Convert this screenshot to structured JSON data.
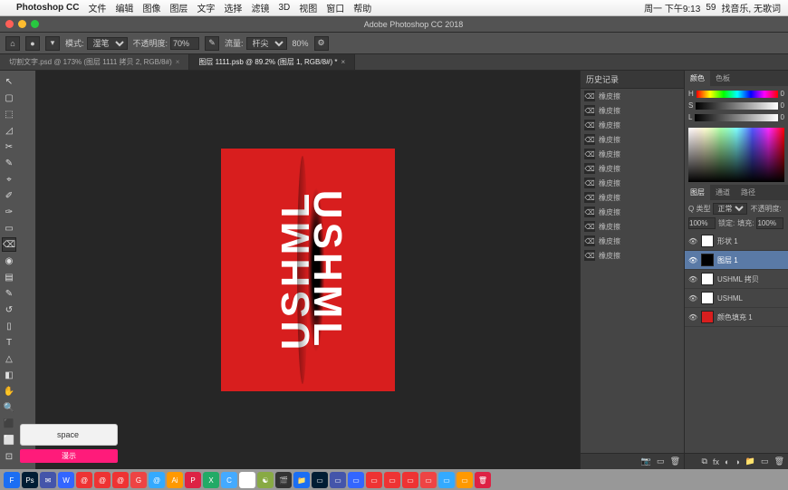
{
  "mac_menu": {
    "apple": "",
    "app_name": "Photoshop CC",
    "items": [
      "文件",
      "编辑",
      "图像",
      "图层",
      "文字",
      "选择",
      "滤镜",
      "3D",
      "视图",
      "窗口",
      "帮助"
    ],
    "right_status": "周一 下午9:13",
    "right_extras": [
      "找音乐, 无歌词"
    ],
    "battery": "59"
  },
  "ps_title": "Adobe Photoshop CC 2018",
  "options": {
    "mode_label": "模式:",
    "mode_value": "湿笔",
    "opacity_label": "不透明度:",
    "opacity_value": "70%",
    "flow_label": "流量:",
    "flow_value": "杆尖",
    "other_label": "80%"
  },
  "doc_tabs": [
    {
      "label": "切割文字.psd @ 173% (图层 1111 拷贝 2, RGB/8#)",
      "active": false
    },
    {
      "label": "图层 1111.psb @ 89.2% (图层 1, RGB/8#) *",
      "active": true
    }
  ],
  "tools": [
    "↖",
    "▢",
    "⬚",
    "◿",
    "✂",
    "✎",
    "⌖",
    "✐",
    "✑",
    "▭",
    "⌫",
    "◉",
    "▤",
    "✎",
    "↺",
    "▯",
    "T",
    "△",
    "◧",
    "✋",
    "🔍",
    "⬛",
    "⬜",
    "⊡"
  ],
  "canvas_text": "USHML",
  "history": {
    "tab": "历史记录",
    "items": [
      "橡皮擦",
      "橡皮擦",
      "橡皮擦",
      "橡皮擦",
      "橡皮擦",
      "橡皮擦",
      "橡皮擦",
      "橡皮擦",
      "橡皮擦",
      "橡皮擦",
      "橡皮擦",
      "橡皮擦"
    ]
  },
  "color": {
    "tab_left": "颜色",
    "tab_right": "色板",
    "h_label": "H",
    "h_val": "0",
    "s_label": "S",
    "s_val": "0",
    "l_label": "L",
    "l_val": "0"
  },
  "layers": {
    "tabs": [
      "图层",
      "通道",
      "路径"
    ],
    "filter_label": "Q 类型",
    "blend_mode": "正常",
    "opacity_label": "不透明度:",
    "opacity_value": "100%",
    "lock_label": "锁定:",
    "fill_label": "填充:",
    "fill_value": "100%",
    "items": [
      {
        "name": "形状 1",
        "sel": false,
        "thumb": "white"
      },
      {
        "name": "图层 1",
        "sel": true,
        "thumb": "mask"
      },
      {
        "name": "USHML 拷贝",
        "sel": false,
        "thumb": "white"
      },
      {
        "name": "USHML",
        "sel": false,
        "thumb": "white"
      },
      {
        "name": "颜色填充 1",
        "sel": false,
        "thumb": "red"
      }
    ]
  },
  "key_overlay": {
    "key": "space",
    "hint": "漫示"
  },
  "dock_apps": [
    "F",
    "Ps",
    "✉",
    "W",
    "@",
    "@",
    "@",
    "G",
    "@",
    "Ai",
    "P",
    "X",
    "C",
    "◯",
    "☯",
    "🎬",
    "📁",
    "▭",
    "▭",
    "▭",
    "▭",
    "▭",
    "▭",
    "▭",
    "▭",
    "▭",
    "🗑"
  ]
}
